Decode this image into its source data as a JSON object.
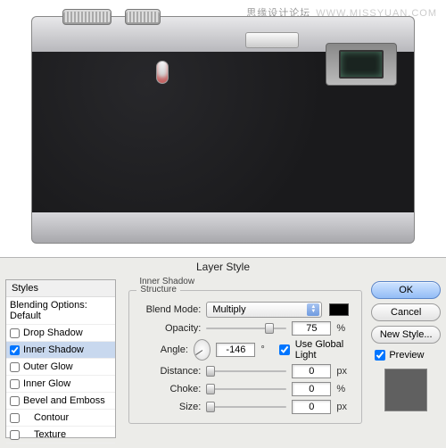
{
  "watermark": {
    "cn": "思缘设计论坛",
    "en": "WWW.MISSYUAN.COM"
  },
  "dialog": {
    "title": "Layer Style",
    "styles_header": "Styles",
    "blending_label": "Blending Options: Default",
    "items": [
      {
        "label": "Drop Shadow",
        "checked": false
      },
      {
        "label": "Inner Shadow",
        "checked": true,
        "selected": true
      },
      {
        "label": "Outer Glow",
        "checked": false
      },
      {
        "label": "Inner Glow",
        "checked": false
      },
      {
        "label": "Bevel and Emboss",
        "checked": false
      },
      {
        "label": "Contour",
        "checked": false
      },
      {
        "label": "Texture",
        "checked": false
      }
    ],
    "panel_title": "Inner Shadow",
    "structure_title": "Structure",
    "blend_mode_label": "Blend Mode:",
    "blend_mode_value": "Multiply",
    "swatch_color": "#000000",
    "opacity_label": "Opacity:",
    "opacity_value": "75",
    "opacity_unit": "%",
    "angle_label": "Angle:",
    "angle_value": "-146",
    "angle_unit": "°",
    "global_light_label": "Use Global Light",
    "global_light_checked": true,
    "distance_label": "Distance:",
    "distance_value": "0",
    "distance_unit": "px",
    "choke_label": "Choke:",
    "choke_value": "0",
    "choke_unit": "%",
    "size_label": "Size:",
    "size_value": "0",
    "size_unit": "px"
  },
  "buttons": {
    "ok": "OK",
    "cancel": "Cancel",
    "new_style": "New Style...",
    "preview": "Preview",
    "preview_checked": true
  }
}
